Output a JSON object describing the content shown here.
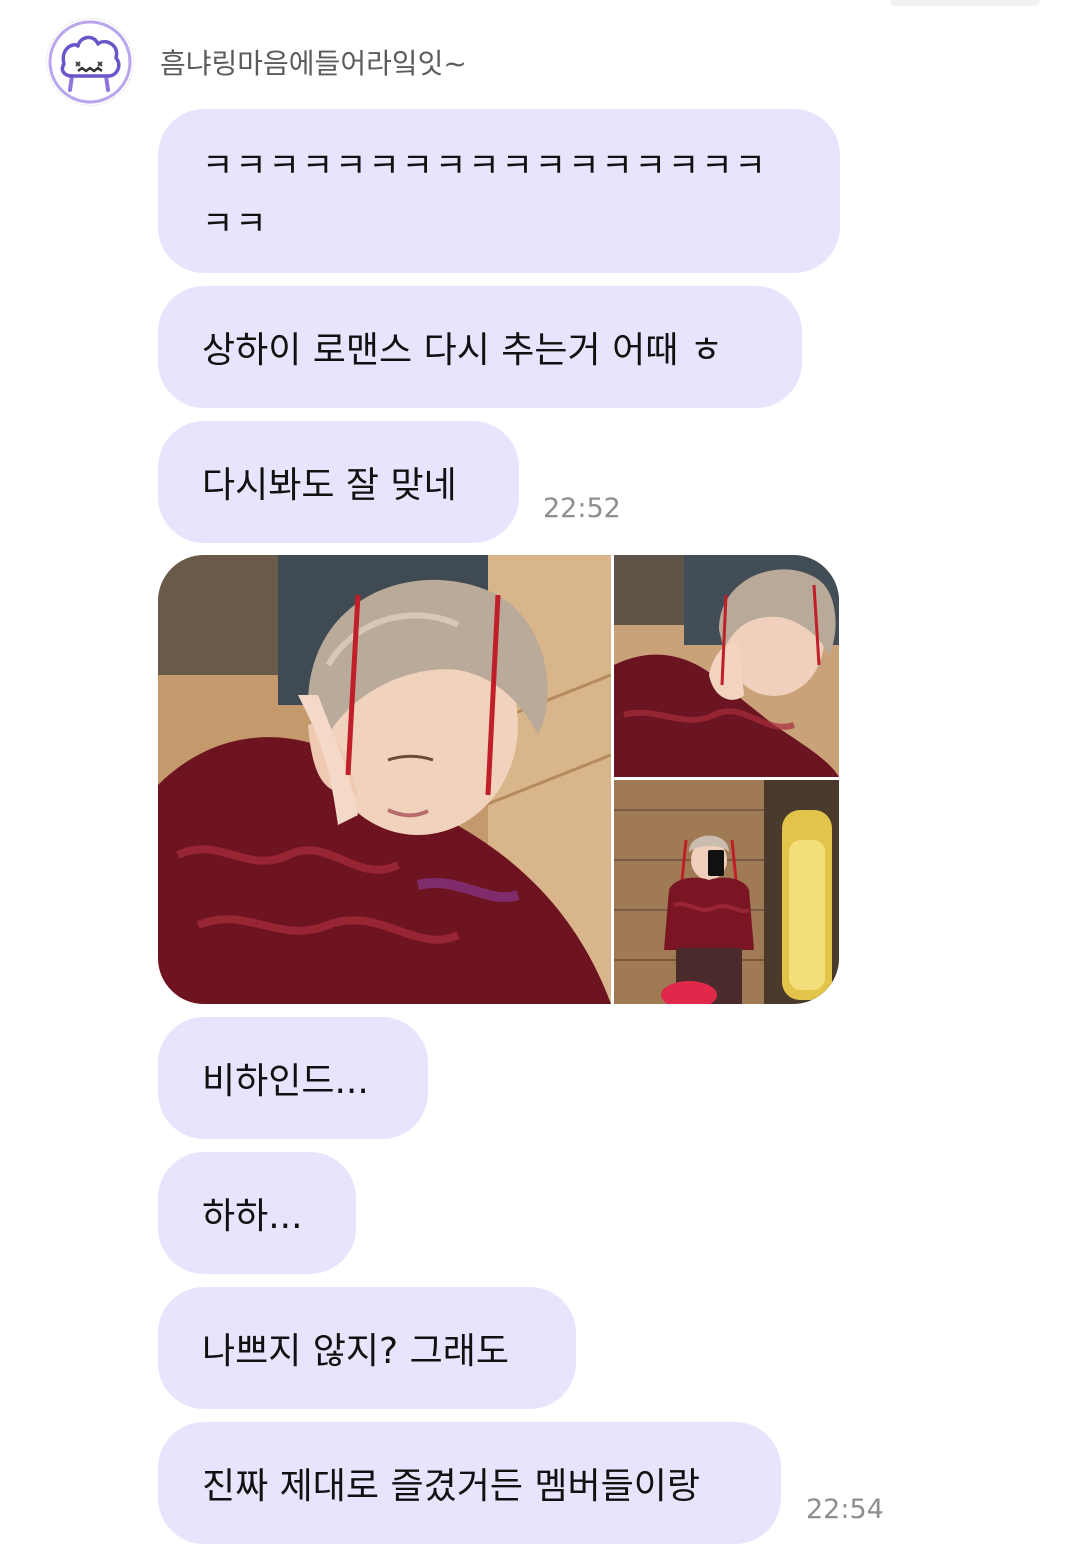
{
  "chat": {
    "sender": {
      "name": "흠냐링마음에들어라잌잇~",
      "avatar_icon": "bread-face-icon"
    },
    "messages": [
      {
        "lines": [
          "ㅋㅋㅋㅋㅋㅋㅋㅋㅋㅋㅋㅋㅋㅋㅋㅋㅋ",
          "ㅋㅋ"
        ]
      },
      {
        "text": "상하이 로맨스 다시 추는거 어때 ㅎ"
      },
      {
        "text": "다시봐도 잘 맞네",
        "time": "22:52"
      },
      {
        "photos": [
          {
            "icon": "selfie-photo"
          },
          {
            "icon": "selfie-photo"
          },
          {
            "icon": "mirror-selfie-photo"
          }
        ]
      },
      {
        "text": "비하인드..."
      },
      {
        "text": "하하..."
      },
      {
        "text": "나쁘지 않지? 그래도"
      },
      {
        "text": "진짜 제대로 즐겼거든 멤버들이랑",
        "time": "22:54"
      }
    ]
  },
  "colors": {
    "bubble_bg": "#e6e5fd",
    "text": "#111111",
    "time_text": "#8e8e8e",
    "name_text": "#5b5b5b",
    "avatar_ring": "#9b7fe0"
  }
}
